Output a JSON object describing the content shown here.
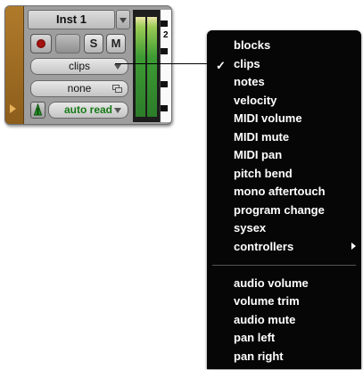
{
  "track": {
    "name": "Inst 1",
    "solo_label": "S",
    "mute_label": "M",
    "view_selector_value": "clips",
    "group_value": "none",
    "automation_mode": "auto read",
    "keyboard_label": "2"
  },
  "menu": {
    "checked_item": "clips",
    "items_group1": [
      "blocks",
      "clips",
      "notes",
      "velocity",
      "MIDI volume",
      "MIDI mute",
      "MIDI pan",
      "pitch bend",
      "mono aftertouch",
      "program change",
      "sysex",
      "controllers"
    ],
    "items_group2": [
      "audio volume",
      "volume trim",
      "audio mute",
      "pan left",
      "pan right"
    ]
  },
  "icons": {
    "record": "record-enable-icon",
    "group": "group-icon",
    "input_monitor": "input-monitor-icon",
    "submenu": "submenu-arrow-icon",
    "check": "checkmark-icon"
  },
  "colors": {
    "track_color": "#9c6a22",
    "menu_bg": "#060606",
    "automation_text": "#167a16",
    "record_red": "#a4130f"
  }
}
